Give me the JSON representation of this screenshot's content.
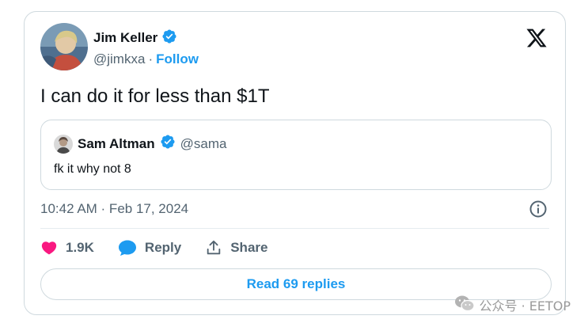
{
  "author": {
    "name": "Jim Keller",
    "handle": "@jimkxa",
    "separator": "·",
    "follow_label": "Follow",
    "verified": true
  },
  "tweet": {
    "text": "I can do it for less than $1T",
    "timestamp": "10:42 AM · Feb 17, 2024"
  },
  "quoted_tweet": {
    "name": "Sam Altman",
    "handle": "@sama",
    "text": "fk it why not 8",
    "verified": true
  },
  "actions": {
    "like_count": "1.9K",
    "reply_label": "Reply",
    "share_label": "Share"
  },
  "read_replies_label": "Read 69 replies",
  "watermark": {
    "text": "公众号 · EETOP"
  },
  "icons": {
    "x_logo": "x-logo-icon",
    "verified": "verified-badge-icon",
    "info": "info-icon",
    "like": "heart-icon",
    "reply": "speech-bubble-icon",
    "share": "share-upload-icon",
    "wechat": "wechat-icon"
  },
  "colors": {
    "text_primary": "#0f1419",
    "text_secondary": "#536471",
    "accent": "#1d9bf0",
    "like": "#f91880",
    "border": "#cfd9de"
  }
}
